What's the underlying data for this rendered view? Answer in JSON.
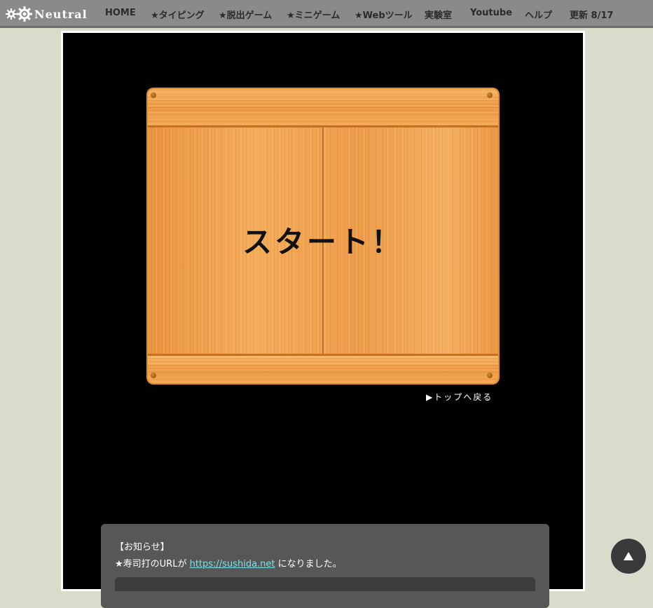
{
  "header": {
    "logo_text": "Neutral",
    "nav": [
      {
        "label": "HOME"
      },
      {
        "label": "★タイピング"
      },
      {
        "label": "★脱出ゲーム"
      },
      {
        "label": "★ミニゲーム"
      },
      {
        "label": "★Webツール"
      },
      {
        "label": "実験室"
      },
      {
        "label": "Youtube"
      },
      {
        "label": "ヘルプ"
      },
      {
        "label": "更新 8/17"
      }
    ]
  },
  "game": {
    "start_label": "スタート！",
    "back_link": "▶トップへ戻る"
  },
  "notice": {
    "title": "【お知らせ】",
    "line_prefix": "★寿司打のURLが ",
    "link_text": "https://sushida.net",
    "line_suffix": " になりました。"
  },
  "colors": {
    "topbar": "#8a8a8a",
    "page_bg": "#d9dccb",
    "stage_bg": "#000000",
    "wood": "#f0a04a",
    "link": "#7ee0e6",
    "notice_bg": "#575757"
  },
  "icons": {
    "logo": "gear-icon",
    "scroll_top": "triangle-up-icon"
  }
}
